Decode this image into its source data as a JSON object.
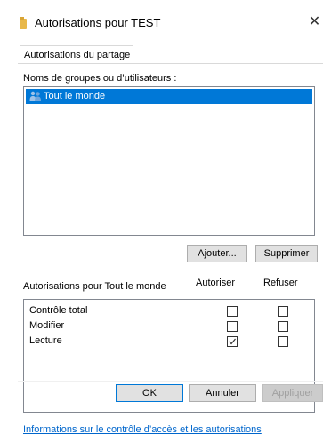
{
  "window": {
    "title": "Autorisations pour TEST",
    "close_glyph": "✕"
  },
  "tabs": [
    {
      "label": "Autorisations du partage"
    }
  ],
  "groups": {
    "label": "Noms de groupes ou d’utilisateurs :",
    "items": [
      {
        "label": "Tout le monde",
        "icon": "users-icon",
        "selected": true
      }
    ]
  },
  "buttons": {
    "add": "Ajouter...",
    "remove": "Supprimer",
    "ok": "OK",
    "cancel": "Annuler",
    "apply": "Appliquer"
  },
  "permissions": {
    "label": "Autorisations pour Tout le monde",
    "columns": {
      "allow": "Autoriser",
      "deny": "Refuser"
    },
    "rows": [
      {
        "label": "Contrôle total",
        "allow": false,
        "deny": false
      },
      {
        "label": "Modifier",
        "allow": false,
        "deny": false
      },
      {
        "label": "Lecture",
        "allow": true,
        "deny": false
      }
    ]
  },
  "help_link": "Informations sur le contrôle d’accès et les autorisations",
  "colors": {
    "selection": "#0078d7",
    "link": "#0066cc",
    "folder": "#e8b84a"
  }
}
